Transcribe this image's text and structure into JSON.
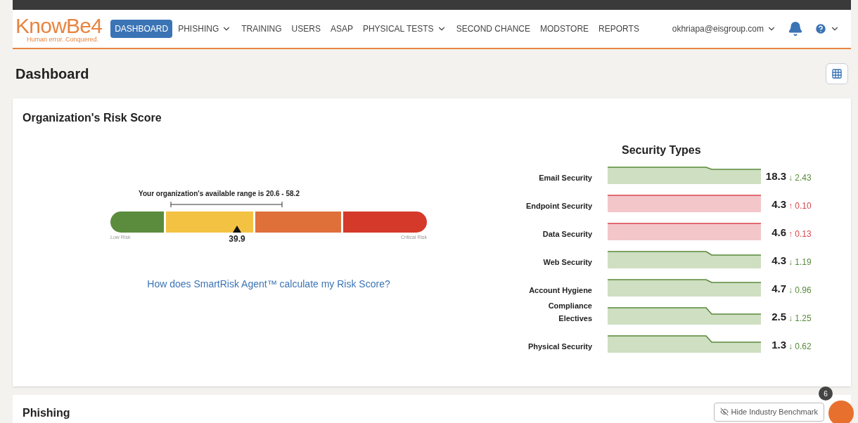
{
  "logo": {
    "name": "KnowBe4",
    "tagline": "Human error. Conquered."
  },
  "nav": [
    {
      "label": "DASHBOARD",
      "selected": true,
      "dropdown": false
    },
    {
      "label": "PHISHING",
      "selected": false,
      "dropdown": true
    },
    {
      "label": "TRAINING",
      "selected": false,
      "dropdown": false
    },
    {
      "label": "USERS",
      "selected": false,
      "dropdown": false
    },
    {
      "label": "ASAP",
      "selected": false,
      "dropdown": false
    },
    {
      "label": "PHYSICAL TESTS",
      "selected": false,
      "dropdown": true
    },
    {
      "label": "SECOND CHANCE",
      "selected": false,
      "dropdown": false
    },
    {
      "label": "MODSTORE",
      "selected": false,
      "dropdown": false
    },
    {
      "label": "REPORTS",
      "selected": false,
      "dropdown": false
    }
  ],
  "user": "okhriapa@eisgroup.com",
  "page_title": "Dashboard",
  "risk_card": {
    "title": "Organization's Risk Score",
    "range_text": "Your organization's available range is 20.6 - 58.2",
    "score": "39.9",
    "low_label": "Low Risk",
    "high_label": "Critical Risk",
    "link": "How does SmartRisk Agent™ calculate my Risk Score?"
  },
  "security_types": {
    "title": "Security Types",
    "rows": [
      {
        "label": "Email Security",
        "score": "18.3",
        "arrow": "↓",
        "delta": "2.43",
        "kind": "down"
      },
      {
        "label": "Endpoint Security",
        "score": "4.3",
        "arrow": "↑",
        "delta": "0.10",
        "kind": "up"
      },
      {
        "label": "Data Security",
        "score": "4.6",
        "arrow": "↑",
        "delta": "0.13",
        "kind": "up"
      },
      {
        "label": "Web Security",
        "score": "4.3",
        "arrow": "↓",
        "delta": "1.19",
        "kind": "down"
      },
      {
        "label": "Account Hygiene",
        "score": "4.7",
        "arrow": "↓",
        "delta": "0.96",
        "kind": "down"
      },
      {
        "label": "Compliance Electives",
        "score": "2.5",
        "arrow": "↓",
        "delta": "1.25",
        "kind": "down"
      },
      {
        "label": "Physical Security",
        "score": "1.3",
        "arrow": "↓",
        "delta": "0.62",
        "kind": "down"
      }
    ]
  },
  "phishing_card": {
    "title": "Phishing",
    "benchmark_button": "Hide Industry Benchmark"
  },
  "help_badge": "6"
}
